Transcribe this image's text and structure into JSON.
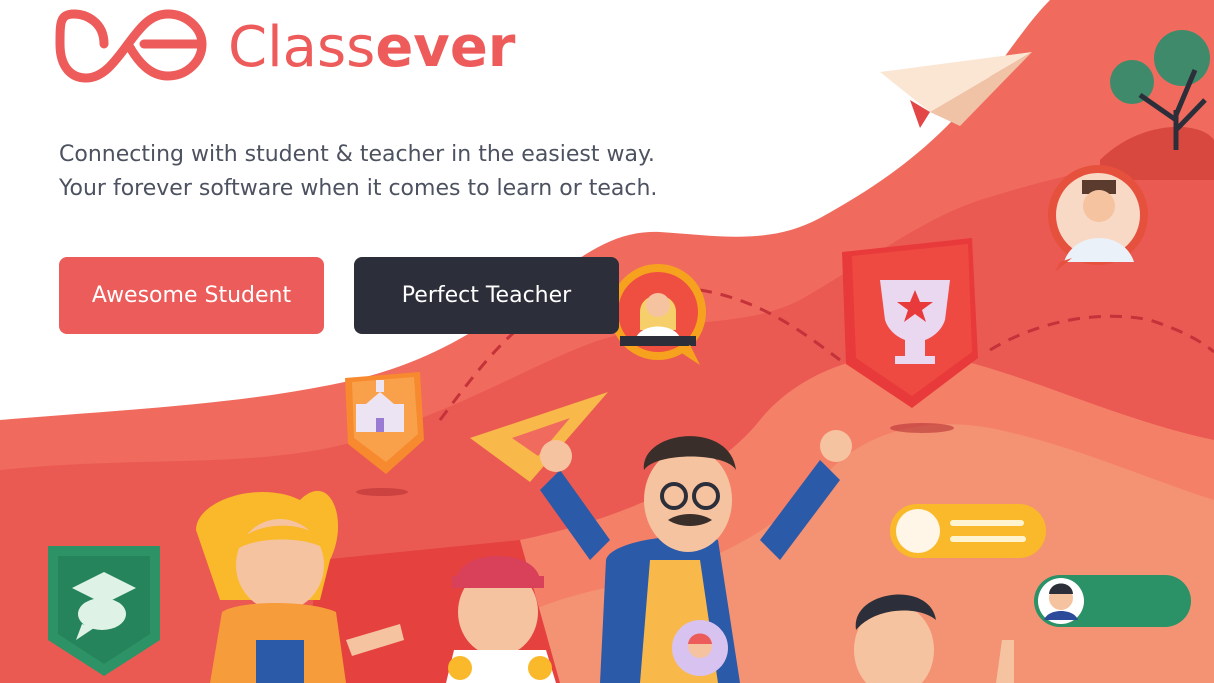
{
  "brand": {
    "name_light": "Class",
    "name_bold": "ever"
  },
  "hero": {
    "tagline_line1": "Connecting with student & teacher in the easiest way.",
    "tagline_line2": "Your forever software when it comes to learn or teach."
  },
  "buttons": {
    "student_label": "Awesome Student",
    "teacher_label": "Perfect Teacher"
  },
  "colors": {
    "brand": "#ee5b5b",
    "student_button": "#ec5c5a",
    "teacher_button": "#2c2f39",
    "text": "#4d5260"
  },
  "illustration": {
    "icons": [
      "paper-plane-icon",
      "tree-icon",
      "teacher-avatar-icon",
      "trophy-badge-icon",
      "school-badge-icon",
      "ruler-triangle-icon",
      "graduation-chat-badge-icon",
      "toggle-switch-icon",
      "user-toggle-icon"
    ]
  }
}
